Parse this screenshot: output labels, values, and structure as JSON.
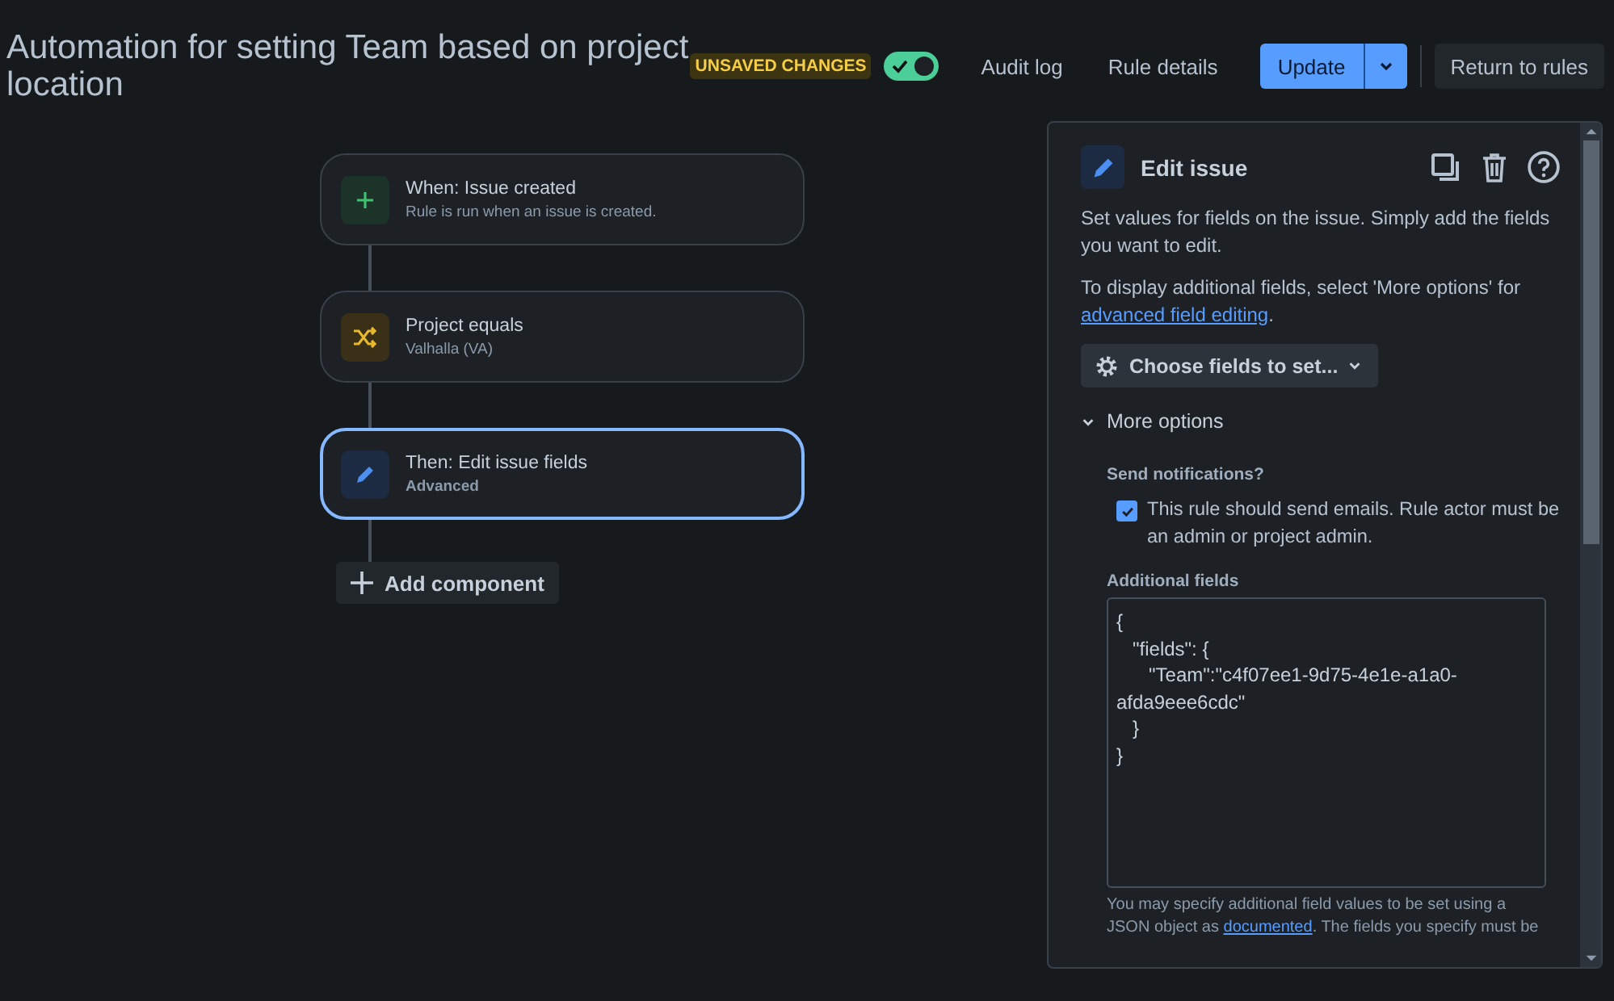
{
  "header": {
    "title": "Automation for setting Team based on project location",
    "badge": "UNSAVED CHANGES",
    "toggle": {
      "on": true
    },
    "links": [
      "Audit log",
      "Rule details"
    ],
    "update_button": "Update",
    "return_button": "Return to rules"
  },
  "flow": {
    "nodes": [
      {
        "kind": "trigger",
        "title": "When: Issue created",
        "subtitle": "Rule is run when an issue is created.",
        "selected": false
      },
      {
        "kind": "condition",
        "title": "Project equals",
        "subtitle": "Valhalla (VA)",
        "selected": false
      },
      {
        "kind": "action",
        "title": "Then: Edit issue fields",
        "subtitle": "Advanced",
        "selected": true
      }
    ],
    "add_button": "Add component"
  },
  "panel": {
    "title": "Edit issue",
    "description": "Set values for fields on the issue. Simply add the fields you want to edit.",
    "hint_before": "To display additional fields, select 'More options' for ",
    "hint_link": "advanced field editing",
    "hint_after": ".",
    "choose_button": "Choose fields to set...",
    "more_options": {
      "label": "More options",
      "expanded": true
    },
    "notifications_label": "Send notifications?",
    "notifications_checkbox": {
      "label": "This rule should send emails. Rule actor must be an admin or project admin.",
      "checked": true
    },
    "additional_fields_label": "Additional fields",
    "additional_fields_value": "{\n   \"fields\": {\n      \"Team\":\"c4f07ee1-9d75-4e1e-a1a0-afda9eee6cdc\"\n   }\n}",
    "help_before": "You may specify additional field values to be set using a JSON object as ",
    "help_link": "documented",
    "help_after": ". The fields you specify must be"
  }
}
